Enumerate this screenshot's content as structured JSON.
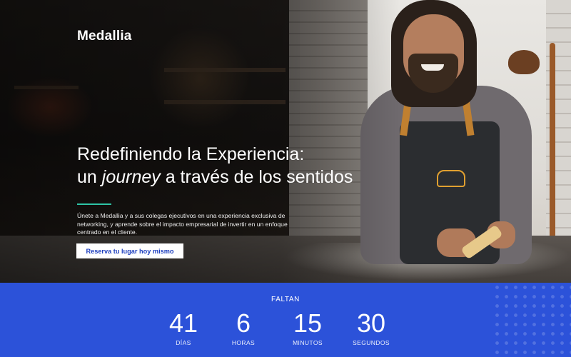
{
  "brand": {
    "logo_text": "Medallia"
  },
  "hero": {
    "headline_line1": "Redefiniendo la Experiencia:",
    "headline_line2_prefix": "un ",
    "headline_line2_emphasis": "journey",
    "headline_line2_suffix": " a través de los sentidos",
    "lede": "Únete a Medallia y a sus colegas ejecutivos en una experiencia exclusiva de networking, y aprende sobre el impacto empresarial de invertir en un enfoque centrado en el cliente.",
    "cta_label": "Reserva tu lugar hoy mismo"
  },
  "countdown": {
    "title": "FALTAN",
    "units": [
      {
        "value": "41",
        "label": "DÍAS"
      },
      {
        "value": "6",
        "label": "HORAS"
      },
      {
        "value": "15",
        "label": "MINUTOS"
      },
      {
        "value": "30",
        "label": "SEGUNDOS"
      }
    ]
  },
  "colors": {
    "countdown_bg": "#2c52d9",
    "cta_text": "#1e3fbf",
    "accent": "#2ec4a6"
  }
}
